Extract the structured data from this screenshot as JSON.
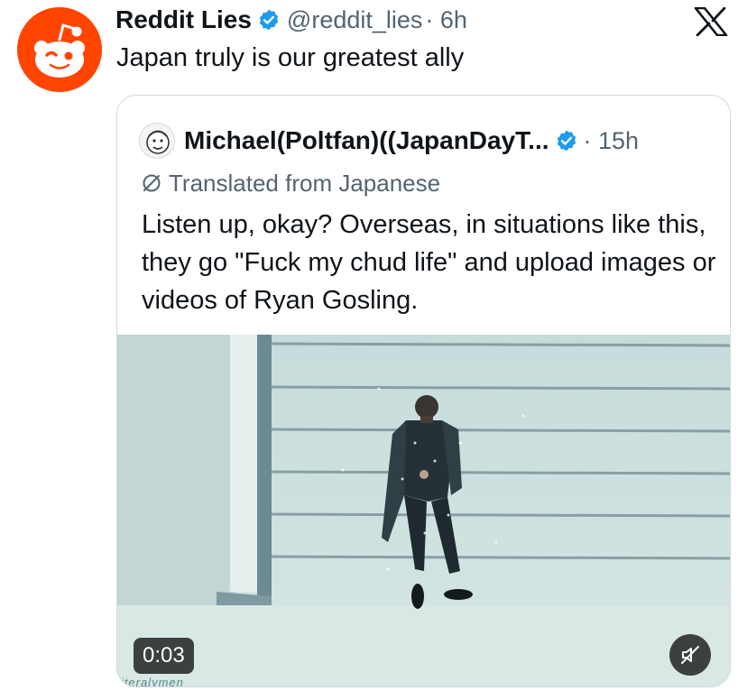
{
  "tweet": {
    "display_name": "Reddit Lies",
    "handle": "@reddit_lies",
    "time": "· 6h",
    "text": "Japan truly is our greatest ally",
    "avatar_icon": "reddit-snoo-icon",
    "platform_icon": "x-logo-icon"
  },
  "quote": {
    "display_name": "Michael(Poltfan)((JapanDayT...",
    "time": "· 15h",
    "translated_label": "Translated from Japanese",
    "text": "Listen up, okay? Overseas, in situations like this, they go \"Fuck my chud life\" and upload images or videos of Ryan Gosling.",
    "media": {
      "video_time": "0:03",
      "watermark": "literalymen",
      "mute_icon": "speaker-muted-icon"
    }
  },
  "colors": {
    "reddit_orange": "#ff4500",
    "verified_blue": "#1d9bf0",
    "muted_text": "#536471",
    "border": "#cfd9de"
  }
}
